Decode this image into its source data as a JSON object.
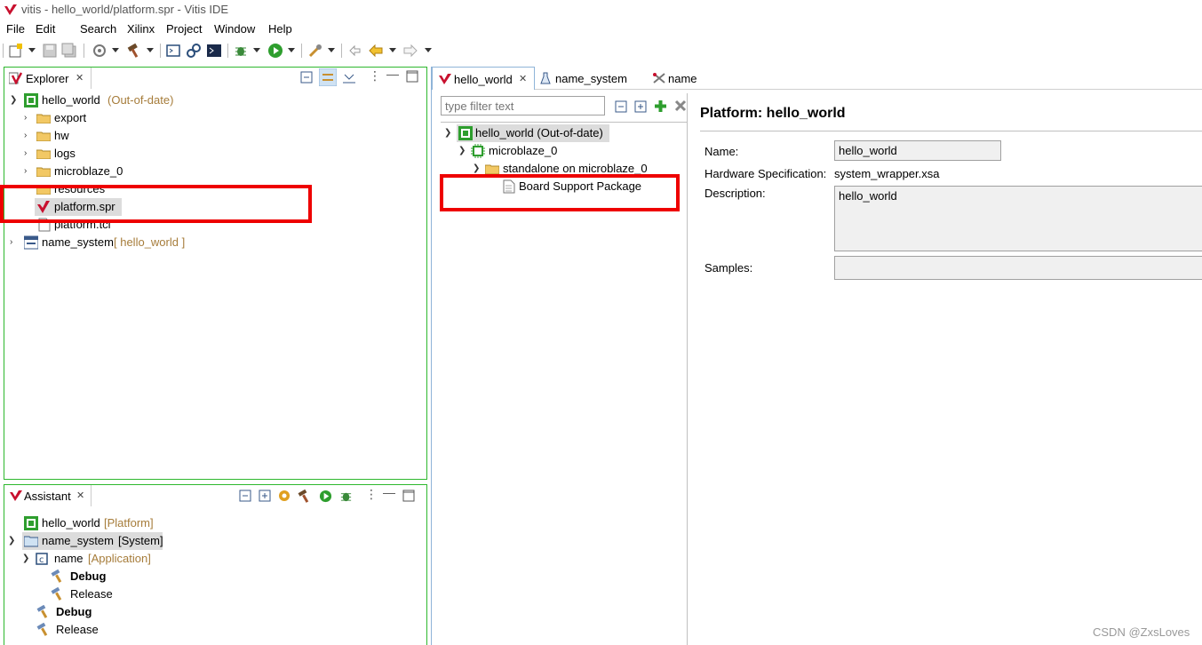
{
  "window": {
    "title": "vitis - hello_world/platform.spr - Vitis IDE"
  },
  "menu": [
    "File",
    "Edit",
    "Search",
    "Xilinx",
    "Project",
    "Window",
    "Help"
  ],
  "explorer": {
    "tab": "Explorer",
    "project": {
      "name": "hello_world",
      "status": "(Out-of-date)"
    },
    "children": [
      "export",
      "hw",
      "logs",
      "microblaze_0",
      "resources",
      "platform.spr",
      "platform.tcl"
    ],
    "system": {
      "name": "name_system",
      "suffix": "[ hello_world ]"
    }
  },
  "assistant": {
    "tab": "Assistant",
    "rows": [
      {
        "name": "hello_world",
        "kind": "[Platform]"
      },
      {
        "name": "name_system",
        "kind": "[System]"
      },
      {
        "name": "name",
        "kind": "[Application]"
      },
      {
        "name": "Debug"
      },
      {
        "name": "Release"
      },
      {
        "name": "Debug"
      },
      {
        "name": "Release"
      }
    ]
  },
  "editor": {
    "tabs": [
      "hello_world",
      "name_system",
      "name"
    ],
    "filter_placeholder": "type filter text",
    "tree": {
      "root": "hello_world (Out-of-date)",
      "cpu": "microblaze_0",
      "os": "standalone on microblaze_0",
      "bsp": "Board Support Package"
    },
    "platform": {
      "heading": "Platform: hello_world",
      "name_label": "Name:",
      "name_value": "hello_world",
      "hw_label": "Hardware Specification:",
      "hw_value": "system_wrapper.xsa",
      "desc_label": "Description:",
      "desc_value": "hello_world",
      "samples_label": "Samples:"
    }
  },
  "watermark": "CSDN @ZxsLoves",
  "colors": {
    "accent": "#2eb82e",
    "highlight": "#e00000",
    "muted": "#a67c3a"
  }
}
